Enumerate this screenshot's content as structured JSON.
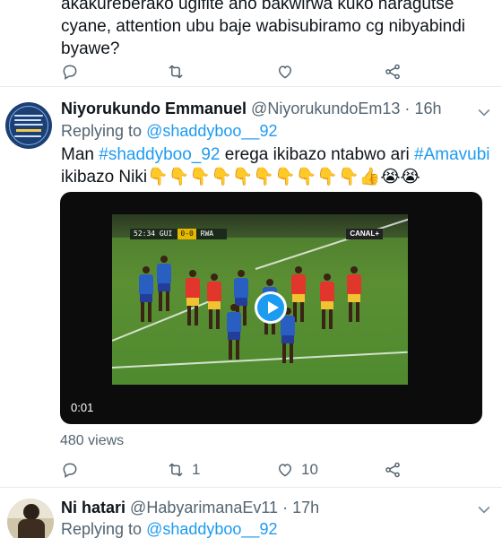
{
  "tweet_top": {
    "text": "akakurebérako ugifite aho bakwirwa kuko haragutse cyane, attention ubu baje wabisubiramo cg nibyabindi byawe?",
    "actions": {
      "reply_count": "",
      "retweet_count": "",
      "like_count": ""
    }
  },
  "tweet_main": {
    "name": "Niyorukundo Emmanuel",
    "handle": "@NiyorukundoEm13",
    "separator": "·",
    "time": "16h",
    "replying_prefix": "Replying to",
    "replying_to": "@shaddyboo__92",
    "body": {
      "t1": "Man ",
      "tag1": "#shaddyboo_92",
      "t2": " erega ikibazo ntabwo ari ",
      "tag2": "#Amavubi",
      "t3": " ikibazo Niki",
      "emojis": "👇👇👇👇👇👇👇👇👇👇👍😭😭"
    },
    "video": {
      "timecode": "0:01",
      "scorebug": "52:34",
      "score": "0-0",
      "teams_left": "GUI",
      "teams_right": "RWA",
      "channel": "CANAL+"
    },
    "views": "480 views",
    "actions": {
      "reply_count": "",
      "retweet_count": "1",
      "like_count": "10"
    }
  },
  "tweet_bottom": {
    "name": "Ni hatari",
    "handle": "@HabyarimanaEv11",
    "separator": "·",
    "time": "17h",
    "replying_prefix": "Replying to",
    "replying_to": "@shaddyboo__92"
  },
  "colors": {
    "accent": "#1d9bf0",
    "muted": "#536471",
    "text": "#0f1419",
    "divider": "#e6ecf0"
  }
}
